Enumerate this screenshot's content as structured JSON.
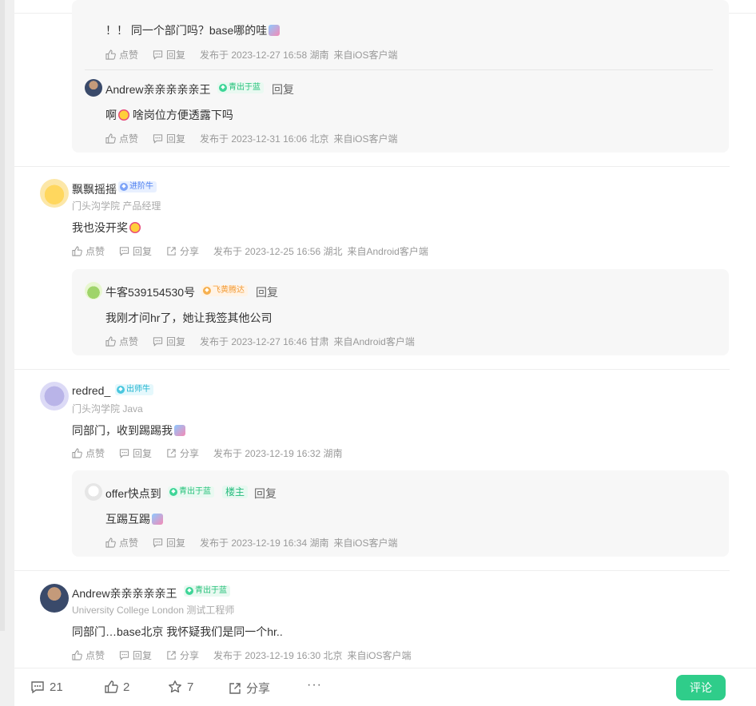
{
  "action_labels": {
    "like": "点赞",
    "reply": "回复",
    "share": "分享"
  },
  "thread0": {
    "reply1": {
      "text": "！！ 同一个部门吗？base哪的哇",
      "meta": "发布于 2023-12-27 16:58 湖南",
      "source": "来自iOS客户端"
    },
    "reply2": {
      "user": "Andrew亲亲亲亲亲王",
      "badge": "青出于蓝",
      "reply_link": "回复",
      "text_before": "啊",
      "text_after": " 啥岗位方便透露下吗",
      "meta": "发布于 2023-12-31 16:06 北京",
      "source": "来自iOS客户端"
    }
  },
  "comments": [
    {
      "user": "飘飘摇摇",
      "badge": "进阶牛",
      "subtitle": "门头沟学院 产品经理",
      "text": "我也没开奖",
      "meta": "发布于 2023-12-25 16:56 湖北",
      "source": "来自Android客户端",
      "reply": {
        "user": "牛客539154530号",
        "badge": "飞黄腾达",
        "reply_link": "回复",
        "text": "我刚才问hr了，她让我签其他公司",
        "meta": "发布于 2023-12-27 16:46 甘肃",
        "source": "来自Android客户端"
      }
    },
    {
      "user": "redred_",
      "badge": "出师牛",
      "subtitle": "门头沟学院 Java",
      "text": "同部门，收到踢踢我",
      "meta": "发布于 2023-12-19 16:32 湖南",
      "source": "",
      "reply": {
        "user": "offer快点到",
        "badge": "青出于蓝",
        "owner_tag": "楼主",
        "reply_link": "回复",
        "text": "互踢互踢",
        "meta": "发布于 2023-12-19 16:34 湖南",
        "source": "来自iOS客户端"
      }
    },
    {
      "user": "Andrew亲亲亲亲亲王",
      "badge": "青出于蓝",
      "subtitle": "University College London 测试工程师",
      "text": "同部门…base北京 我怀疑我们是同一个hr..",
      "meta": "发布于 2023-12-19 16:30 北京",
      "source": "来自iOS客户端"
    }
  ],
  "bottom_bar": {
    "comments_count": "21",
    "likes_count": "2",
    "favorites_count": "7",
    "share_label": "分享",
    "more_label": "···",
    "comment_button": "评论"
  },
  "colors": {
    "accent": "#2fcd8a",
    "reply_bg": "#f7f7f7"
  }
}
